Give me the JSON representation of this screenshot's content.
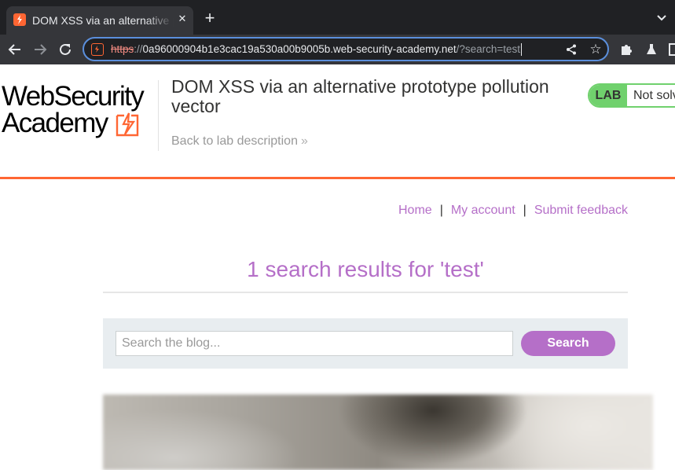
{
  "browser": {
    "tab": {
      "title": "DOM XSS via an alternative prototype pollution vector",
      "close_glyph": "✕"
    },
    "new_tab_glyph": "+",
    "address_bar": {
      "scheme": "https",
      "separator": "://",
      "host": "0a96000904b1e3cac19a530a00b9005b.web-security-academy.net",
      "path": "/?search=test"
    },
    "star_glyph": "☆"
  },
  "header": {
    "logo": {
      "line1": "WebSecurity",
      "line2": "Academy"
    },
    "lab_title": "DOM XSS via an alternative prototype pollution vector",
    "back_link": "Back to lab description",
    "back_chevron": "»",
    "lab_badge": {
      "tag": "LAB",
      "status": "Not solved"
    }
  },
  "nav": {
    "home": "Home",
    "my_account": "My account",
    "submit_feedback": "Submit feedback",
    "separator": "|"
  },
  "results": {
    "heading": "1 search results for 'test'"
  },
  "search": {
    "placeholder": "Search the blog...",
    "button_label": "Search"
  },
  "colors": {
    "accent_orange": "#ff6633",
    "link_purple": "#b56fc8",
    "lab_green": "#70d16d",
    "browser_dark": "#202124",
    "focus_ring_blue": "#5b8fdc"
  }
}
